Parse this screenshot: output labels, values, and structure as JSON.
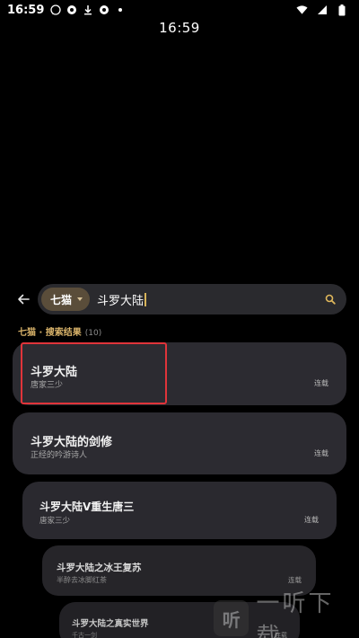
{
  "status_bar": {
    "time": "16:59",
    "left_icons": [
      "whatsapp-icon",
      "app-icon",
      "download-icon",
      "app-icon",
      "dot-icon"
    ],
    "right_icons": [
      "wifi-icon",
      "signal-icon",
      "battery-icon"
    ]
  },
  "clock": "16:59",
  "search": {
    "source_label": "七猫",
    "query": "斗罗大陆"
  },
  "results_header": {
    "label": "七猫 · 搜索结果",
    "count": "(10)"
  },
  "results": [
    {
      "title": "斗罗大陆",
      "author": "唐家三少",
      "status": "连载"
    },
    {
      "title": "斗罗大陆的剑修",
      "author": "正经的吟游诗人",
      "status": "连载"
    },
    {
      "title": "斗罗大陆V重生唐三",
      "author": "唐家三少",
      "status": "连载"
    },
    {
      "title": "斗罗大陆之冰王复苏",
      "author": "半醉去冰脚红茶",
      "status": "连载"
    },
    {
      "title": "斗罗大陆之真实世界",
      "author": "千古一剑",
      "status": "连载"
    }
  ],
  "watermark": {
    "logo_char": "听",
    "text": "一听下载"
  },
  "colors": {
    "accent": "#d9b36a",
    "card_bg": "#2c2b31",
    "chip_bg": "#5a4d3a",
    "highlight": "#e0343a"
  }
}
